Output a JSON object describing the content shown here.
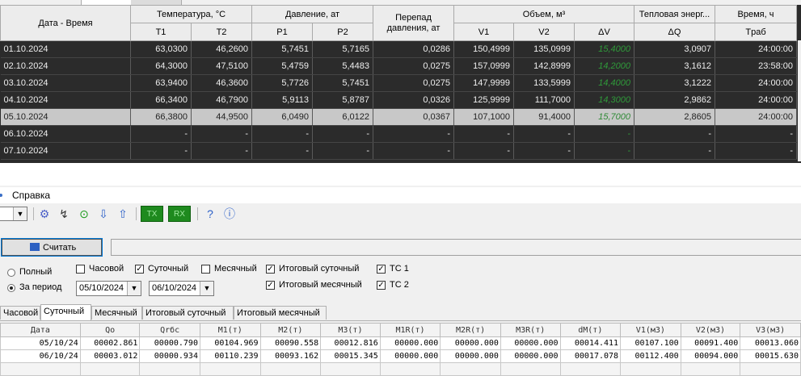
{
  "top_table": {
    "headers": {
      "date": "Дата - Время",
      "temp_group": "Температура, °С",
      "t1": "T1",
      "t2": "T2",
      "pres_group": "Давление, ат",
      "p1": "P1",
      "p2": "P2",
      "diff_l1": "Перепад",
      "diff_l2": "давления, ат",
      "vol_group": "Объем, м³",
      "v1": "V1",
      "v2": "V2",
      "dv": "ΔV",
      "heat_group": "Тепловая энерг...",
      "dq": "ΔQ",
      "time_group": "Время, ч",
      "traб": "Tраб"
    },
    "rows": [
      [
        "01.10.2024",
        "63,0300",
        "46,2600",
        "5,7451",
        "5,7165",
        "0,0286",
        "150,4999",
        "135,0999",
        "15,4000",
        "3,0907",
        "24:00:00"
      ],
      [
        "02.10.2024",
        "64,3000",
        "47,5100",
        "5,4759",
        "5,4483",
        "0,0275",
        "157,0999",
        "142,8999",
        "14,2000",
        "3,1612",
        "23:58:00"
      ],
      [
        "03.10.2024",
        "63,9400",
        "46,3600",
        "5,7726",
        "5,7451",
        "0,0275",
        "147,9999",
        "133,5999",
        "14,4000",
        "3,1222",
        "24:00:00"
      ],
      [
        "04.10.2024",
        "66,3400",
        "46,7900",
        "5,9113",
        "5,8787",
        "0,0326",
        "125,9999",
        "111,7000",
        "14,3000",
        "2,9862",
        "24:00:00"
      ],
      [
        "05.10.2024",
        "66,3800",
        "44,9500",
        "6,0490",
        "6,0122",
        "0,0367",
        "107,1000",
        "91,4000",
        "15,7000",
        "2,8605",
        "24:00:00"
      ],
      [
        "06.10.2024",
        "-",
        "-",
        "-",
        "-",
        "-",
        "-",
        "-",
        "-",
        "-",
        "-"
      ],
      [
        "07.10.2024",
        "-",
        "-",
        "-",
        "-",
        "-",
        "-",
        "-",
        "-",
        "-",
        "-"
      ]
    ]
  },
  "menu": {
    "help": "Справка"
  },
  "toolbar": {
    "tx": "TX",
    "rx": "RX"
  },
  "read_button": "Считать",
  "options": {
    "radio_full": "Полный",
    "radio_period": "За период",
    "chk_hourly": "Часовой",
    "chk_daily": "Суточный",
    "chk_monthly": "Месячный",
    "chk_total_daily": "Итоговый суточный",
    "chk_total_monthly": "Итоговый месячный",
    "chk_tc1": "ТС 1",
    "chk_tc2": "ТС 2",
    "date_from": "05/10/2024",
    "date_to": "06/10/2024"
  },
  "tabs": [
    "Часовой",
    "Суточный",
    "Месячный",
    "Итоговый суточный",
    "Итоговый месячный"
  ],
  "grid": {
    "headers": [
      "Дата",
      "Qo",
      "Qrбc",
      "M1(т)",
      "M2(т)",
      "M3(т)",
      "M1R(т)",
      "M2R(т)",
      "M3R(т)",
      "dM(т)",
      "V1(м3)",
      "V2(м3)",
      "V3(м3)"
    ],
    "rows": [
      [
        "05/10/24",
        "00002.861",
        "00000.790",
        "00104.969",
        "00090.558",
        "00012.816",
        "00000.000",
        "00000.000",
        "00000.000",
        "00014.411",
        "00107.100",
        "00091.400",
        "00013.060"
      ],
      [
        "06/10/24",
        "00003.012",
        "00000.934",
        "00110.239",
        "00093.162",
        "00015.345",
        "00000.000",
        "00000.000",
        "00000.000",
        "00017.078",
        "00112.400",
        "00094.000",
        "00015.630"
      ]
    ]
  },
  "colors": {
    "dark_bg": "#2b2b2b",
    "dv_green": "#2f9a3a",
    "tx_green": "#1e8a1e"
  }
}
